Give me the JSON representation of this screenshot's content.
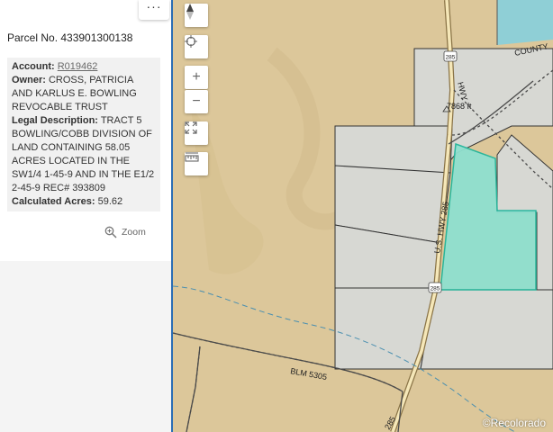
{
  "panel": {
    "more_label": "···",
    "parcel_title": "Parcel No. 433901300138",
    "account_label": "Account:",
    "account_value": "R019462",
    "owner_label": "Owner:",
    "owner_value": "CROSS, PATRICIA AND KARLUS E. BOWLING REVOCABLE TRUST",
    "legal_label": "Legal Description:",
    "legal_value": "TRACT 5 BOWLING/COBB DIVISION OF LAND CONTAINING 58.05 ACRES LOCATED IN THE SW1/4 1-45-9 AND IN THE E1/2 2-45-9 REC# 393809",
    "acres_label": "Calculated Acres:",
    "acres_value": "59.62",
    "zoom_label": "Zoom"
  },
  "map": {
    "controls": {
      "zoom_in": "+",
      "zoom_out": "−"
    },
    "labels": {
      "county": "COUNTY",
      "hwy_east": "HWY",
      "elevation": "7868 ft",
      "us_hwy": "U.S. HWY 285",
      "shield_285_top": "285",
      "shield_285_mid": "285",
      "blm": "BLM 5305",
      "hwy_bottom": "285"
    },
    "attribution": "©Recolorado",
    "colors": {
      "terrain": "#dcc79a",
      "parcel_fill": "#d7d8d3",
      "selected_fill": "#8fe0cf",
      "selected_stroke": "#22b59b",
      "water": "#8fcfd6",
      "road": "#8a7447",
      "highway_fill": "#f5e7b8"
    }
  }
}
